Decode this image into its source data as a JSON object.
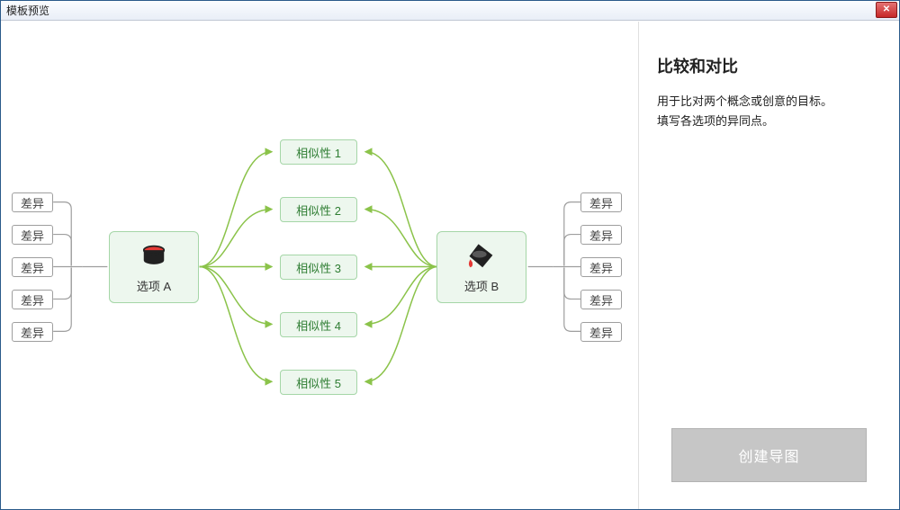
{
  "window": {
    "title": "模板预览"
  },
  "side": {
    "heading": "比较和对比",
    "desc_line1": "用于比对两个概念或创意的目标。",
    "desc_line2": "填写各选项的异同点。",
    "button_label": "创建导图"
  },
  "diagram": {
    "option_a_label": "选项 A",
    "option_b_label": "选项 B",
    "diff_label": "差异",
    "similar_prefix": "相似性",
    "sim1": "相似性 1",
    "sim2": "相似性 2",
    "sim3": "相似性 3",
    "sim4": "相似性 4",
    "sim5": "相似性 5"
  },
  "icons": {
    "close_glyph": "✕"
  }
}
